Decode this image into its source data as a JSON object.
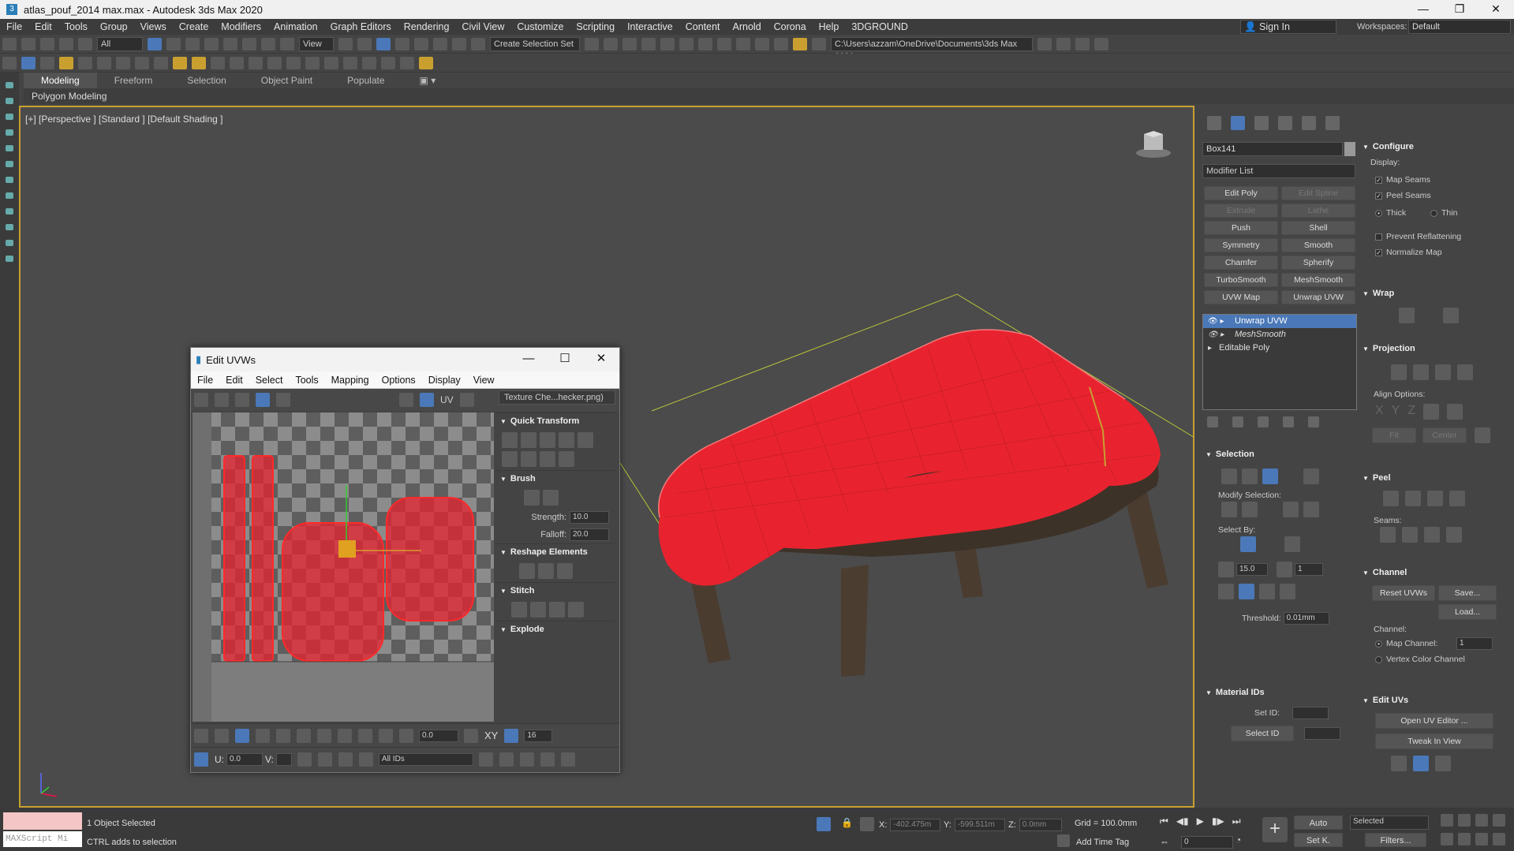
{
  "window": {
    "title": "atlas_pouf_2014 max.max - Autodesk 3ds Max 2020",
    "minimize": "—",
    "restore": "❐",
    "close": "✕"
  },
  "menu": [
    "File",
    "Edit",
    "Tools",
    "Group",
    "Views",
    "Create",
    "Modifiers",
    "Animation",
    "Graph Editors",
    "Rendering",
    "Civil View",
    "Customize",
    "Scripting",
    "Interactive",
    "Content",
    "Arnold",
    "Corona",
    "Help",
    "3DGROUND"
  ],
  "signin": "Sign In",
  "workspaces": {
    "label": "Workspaces:",
    "value": "Default"
  },
  "toolbar": {
    "filter": "All",
    "refcoord": "View",
    "selset": "Create Selection Set",
    "path": "C:\\Users\\azzam\\OneDrive\\Documents\\3ds Max 2020"
  },
  "ribbon": {
    "tabs": [
      "Modeling",
      "Freeform",
      "Selection",
      "Object Paint",
      "Populate"
    ],
    "sub": "Polygon Modeling"
  },
  "viewport": {
    "label": "[+] [Perspective ] [Standard ] [Default Shading ]"
  },
  "uv": {
    "title": "Edit UVWs",
    "menu": [
      "File",
      "Edit",
      "Select",
      "Tools",
      "Mapping",
      "Options",
      "Display",
      "View"
    ],
    "texture": "Texture Che...hecker.png)",
    "uv_label": "UV",
    "sections": {
      "quick": "Quick Transform",
      "brush": "Brush",
      "reshape": "Reshape Elements",
      "stitch": "Stitch",
      "explode": "Explode"
    },
    "strength": {
      "label": "Strength:",
      "value": "10.0"
    },
    "falloff": {
      "label": "Falloff:",
      "value": "20.0"
    },
    "bottom": {
      "angle": "0.0",
      "xy": "XY",
      "grid": "16",
      "u_label": "U:",
      "u_value": "0.0",
      "v_label": "V:",
      "ids": "All IDs"
    }
  },
  "cmd": {
    "object": "Box141",
    "modlist": "Modifier List",
    "buttons": [
      {
        "label": "Edit Poly",
        "disabled": false
      },
      {
        "label": "Edit Spline",
        "disabled": true
      },
      {
        "label": "Extrude",
        "disabled": true
      },
      {
        "label": "Lathe",
        "disabled": true
      },
      {
        "label": "Push",
        "disabled": false
      },
      {
        "label": "Shell",
        "disabled": false
      },
      {
        "label": "Symmetry",
        "disabled": false
      },
      {
        "label": "Smooth",
        "disabled": false
      },
      {
        "label": "Chamfer",
        "disabled": false
      },
      {
        "label": "Spherify",
        "disabled": false
      },
      {
        "label": "TurboSmooth",
        "disabled": false
      },
      {
        "label": "MeshSmooth",
        "disabled": false
      },
      {
        "label": "UVW Map",
        "disabled": false
      },
      {
        "label": "Unwrap UVW",
        "disabled": false
      }
    ],
    "stack": [
      "Unwrap UVW",
      "MeshSmooth",
      "Editable Poly"
    ],
    "selection": {
      "title": "Selection",
      "modify": "Modify Selection:",
      "selectby": "Select By:",
      "angle": "15.0",
      "count": "1",
      "threshold_label": "Threshold:",
      "threshold": "0.01mm"
    },
    "material": {
      "title": "Material IDs",
      "setid": "Set ID:",
      "selectid": "Select ID"
    }
  },
  "right": {
    "configure": "Configure",
    "display": "Display:",
    "map_seams": "Map Seams",
    "peel_seams": "Peel Seams",
    "thick": "Thick",
    "thin": "Thin",
    "prevent": "Prevent Reflattening",
    "normalize": "Normalize Map",
    "wrap": "Wrap",
    "projection": "Projection",
    "align": "Align Options:",
    "xyz": [
      "X",
      "Y",
      "Z"
    ],
    "fit": "Fit",
    "center": "Center",
    "peel": "Peel",
    "seams": "Seams:",
    "channel": "Channel",
    "reset": "Reset UVWs",
    "save": "Save...",
    "load": "Load...",
    "channel_label": "Channel:",
    "map_channel": "Map Channel:",
    "map_channel_val": "1",
    "vertex_color": "Vertex Color Channel",
    "edit_uvs": "Edit UVs",
    "open_editor": "Open UV Editor ...",
    "tweak": "Tweak In View"
  },
  "status": {
    "selected": "1 Object Selected",
    "hint": "CTRL adds to selection",
    "maxscript": "MAXScript Mi",
    "x_label": "X:",
    "x": "-402.475m",
    "y_label": "Y:",
    "y": "-599.511m",
    "z_label": "Z:",
    "z": "0.0mm",
    "grid": "Grid = 100.0mm",
    "auto": "Auto",
    "selected_mode": "Selected",
    "setk": "Set K.",
    "filters": "Filters...",
    "frame": "0",
    "timetag": "Add Time Tag"
  },
  "colors": {
    "accent": "#4a78b8",
    "viewport_border": "#c9a030",
    "uv_shell": "#e8232f"
  }
}
